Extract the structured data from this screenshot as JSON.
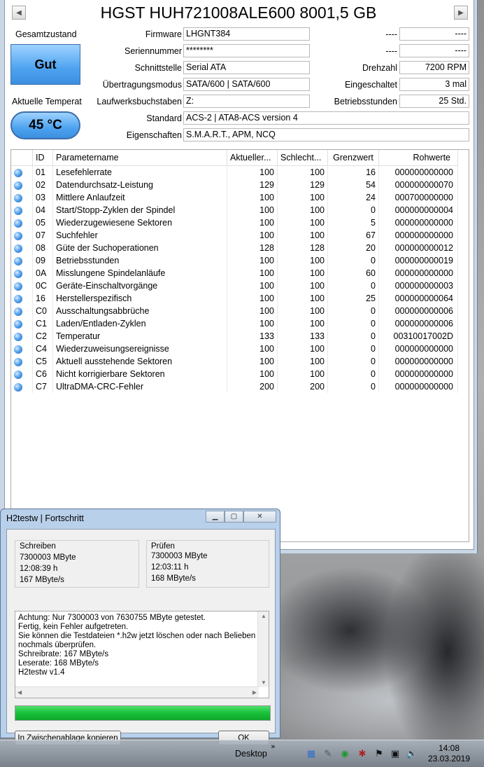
{
  "drive": {
    "title": "HGST HUH721008ALE600 8001,5 GB",
    "nav_prev": "◀",
    "nav_next": "▶"
  },
  "status": {
    "overall_label": "Gesamtzustand",
    "overall_value": "Gut",
    "temp_label": "Aktuelle Temperat",
    "temp_value": "45 °C",
    "health_color": "#4ea3f0"
  },
  "info": {
    "firmware_label": "Firmware",
    "firmware": "LHGNT384",
    "serial_label": "Seriennummer",
    "serial": "********",
    "interface_label": "Schnittstelle",
    "interface": "Serial ATA",
    "transfer_label": "Übertragungsmodus",
    "transfer": "SATA/600 | SATA/600",
    "drive_letter_label": "Laufwerksbuchstaben",
    "drive_letter": "Z:",
    "standard_label": "Standard",
    "standard": "ACS-2 | ATA8-ACS version 4",
    "features_label": "Eigenschaften",
    "features": "S.M.A.R.T., APM, NCQ",
    "right1_label": "----",
    "right1_value": "----",
    "right2_label": "----",
    "right2_value": "----",
    "rpm_label": "Drehzahl",
    "rpm": "7200 RPM",
    "power_on_count_label": "Eingeschaltet",
    "power_on_count": "3 mal",
    "power_on_hours_label": "Betriebsstunden",
    "power_on_hours": "25 Std."
  },
  "smart": {
    "headers": [
      "ID",
      "Parametername",
      "Aktueller...",
      "Schlecht...",
      "Grenzwert",
      "Rohwerte"
    ],
    "rows": [
      {
        "id": "01",
        "name": "Lesefehlerrate",
        "cur": "100",
        "worst": "100",
        "thr": "16",
        "raw": "000000000000"
      },
      {
        "id": "02",
        "name": "Datendurchsatz-Leistung",
        "cur": "129",
        "worst": "129",
        "thr": "54",
        "raw": "000000000070"
      },
      {
        "id": "03",
        "name": "Mittlere Anlaufzeit",
        "cur": "100",
        "worst": "100",
        "thr": "24",
        "raw": "000700000000"
      },
      {
        "id": "04",
        "name": "Start/Stopp-Zyklen der Spindel",
        "cur": "100",
        "worst": "100",
        "thr": "0",
        "raw": "000000000004"
      },
      {
        "id": "05",
        "name": "Wiederzugewiesene Sektoren",
        "cur": "100",
        "worst": "100",
        "thr": "5",
        "raw": "000000000000"
      },
      {
        "id": "07",
        "name": "Suchfehler",
        "cur": "100",
        "worst": "100",
        "thr": "67",
        "raw": "000000000000"
      },
      {
        "id": "08",
        "name": "Güte der Suchoperationen",
        "cur": "128",
        "worst": "128",
        "thr": "20",
        "raw": "000000000012"
      },
      {
        "id": "09",
        "name": "Betriebsstunden",
        "cur": "100",
        "worst": "100",
        "thr": "0",
        "raw": "000000000019"
      },
      {
        "id": "0A",
        "name": "Misslungene Spindelanläufe",
        "cur": "100",
        "worst": "100",
        "thr": "60",
        "raw": "000000000000"
      },
      {
        "id": "0C",
        "name": "Geräte-Einschaltvorgänge",
        "cur": "100",
        "worst": "100",
        "thr": "0",
        "raw": "000000000003"
      },
      {
        "id": "16",
        "name": "Herstellerspezifisch",
        "cur": "100",
        "worst": "100",
        "thr": "25",
        "raw": "000000000064"
      },
      {
        "id": "C0",
        "name": "Ausschaltungsabbrüche",
        "cur": "100",
        "worst": "100",
        "thr": "0",
        "raw": "000000000006"
      },
      {
        "id": "C1",
        "name": "Laden/Entladen-Zyklen",
        "cur": "100",
        "worst": "100",
        "thr": "0",
        "raw": "000000000006"
      },
      {
        "id": "C2",
        "name": "Temperatur",
        "cur": "133",
        "worst": "133",
        "thr": "0",
        "raw": "00310017002D"
      },
      {
        "id": "C4",
        "name": "Wiederzuweisungsereignisse",
        "cur": "100",
        "worst": "100",
        "thr": "0",
        "raw": "000000000000"
      },
      {
        "id": "C5",
        "name": "Aktuell ausstehende Sektoren",
        "cur": "100",
        "worst": "100",
        "thr": "0",
        "raw": "000000000000"
      },
      {
        "id": "C6",
        "name": "Nicht korrigierbare Sektoren",
        "cur": "100",
        "worst": "100",
        "thr": "0",
        "raw": "000000000000"
      },
      {
        "id": "C7",
        "name": "UltraDMA-CRC-Fehler",
        "cur": "200",
        "worst": "200",
        "thr": "0",
        "raw": "000000000000"
      }
    ]
  },
  "progress": {
    "window_title": "H2testw | Fortschritt",
    "write": {
      "title": "Schreiben",
      "size": "7300003 MByte",
      "time": "12:08:39 h",
      "rate": "167 MByte/s"
    },
    "verify": {
      "title": "Prüfen",
      "size": "7300003 MByte",
      "time": "12:03:11 h",
      "rate": "168 MByte/s"
    },
    "message_lines": [
      "Achtung: Nur 7300003 von 7630755 MByte getestet.",
      "Fertig, kein Fehler aufgetreten.",
      "Sie können die Testdateien *.h2w jetzt löschen oder nach Belieben",
      "nochmals überprüfen.",
      "Schreibrate: 167 MByte/s",
      "Leserate: 168 MByte/s",
      "H2testw v1.4"
    ],
    "progress_fraction": 1.0,
    "copy_button": "In Zwischenablage kopieren",
    "ok_button": "OK"
  },
  "taskbar": {
    "desktop_label": "Desktop",
    "chevron": "»",
    "time": "14:08",
    "date": "23.03.2019"
  }
}
